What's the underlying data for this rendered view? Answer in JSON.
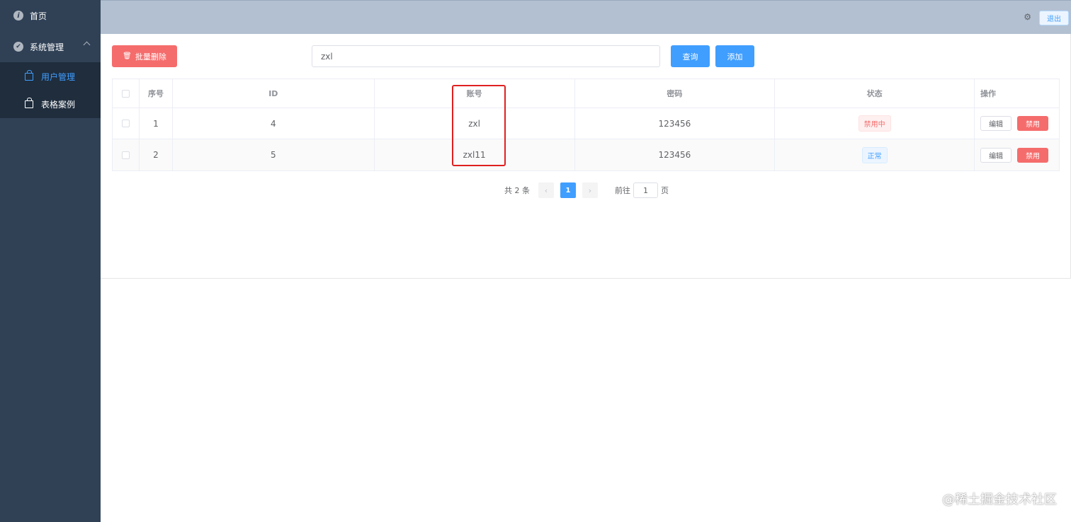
{
  "sidebar": {
    "items": [
      {
        "label": "首页",
        "icon": "info-icon"
      },
      {
        "label": "系统管理",
        "icon": "check-circle-icon",
        "expanded": true
      }
    ],
    "submenu": [
      {
        "label": "用户管理",
        "active": true,
        "icon": "bag-icon"
      },
      {
        "label": "表格案例",
        "active": false,
        "icon": "bag-icon"
      }
    ]
  },
  "header": {
    "settings_icon": "⚙",
    "logout_label": "退出"
  },
  "toolbar": {
    "batch_delete_label": "批量删除",
    "search_value": "zxl",
    "query_label": "查询",
    "add_label": "添加"
  },
  "table": {
    "columns": [
      "序号",
      "ID",
      "账号",
      "密码",
      "状态",
      "操作"
    ],
    "rows": [
      {
        "no": "1",
        "id": "4",
        "account": "zxl",
        "password": "123456",
        "status": "禁用中",
        "status_type": "danger",
        "edit": "编辑",
        "action": "禁用"
      },
      {
        "no": "2",
        "id": "5",
        "account": "zxl11",
        "password": "123456",
        "status": "正常",
        "status_type": "info",
        "edit": "编辑",
        "action": "禁用"
      }
    ]
  },
  "pagination": {
    "total_text": "共 2 条",
    "current_page": "1",
    "goto_label": "前往",
    "goto_value": "1",
    "page_suffix": "页"
  },
  "watermark": "@稀土掘金技术社区",
  "colors": {
    "sidebar_bg": "#304156",
    "header_bg": "#b3c0d1",
    "primary": "#409eff",
    "danger": "#f56c6c",
    "highlight": "#e02020"
  }
}
